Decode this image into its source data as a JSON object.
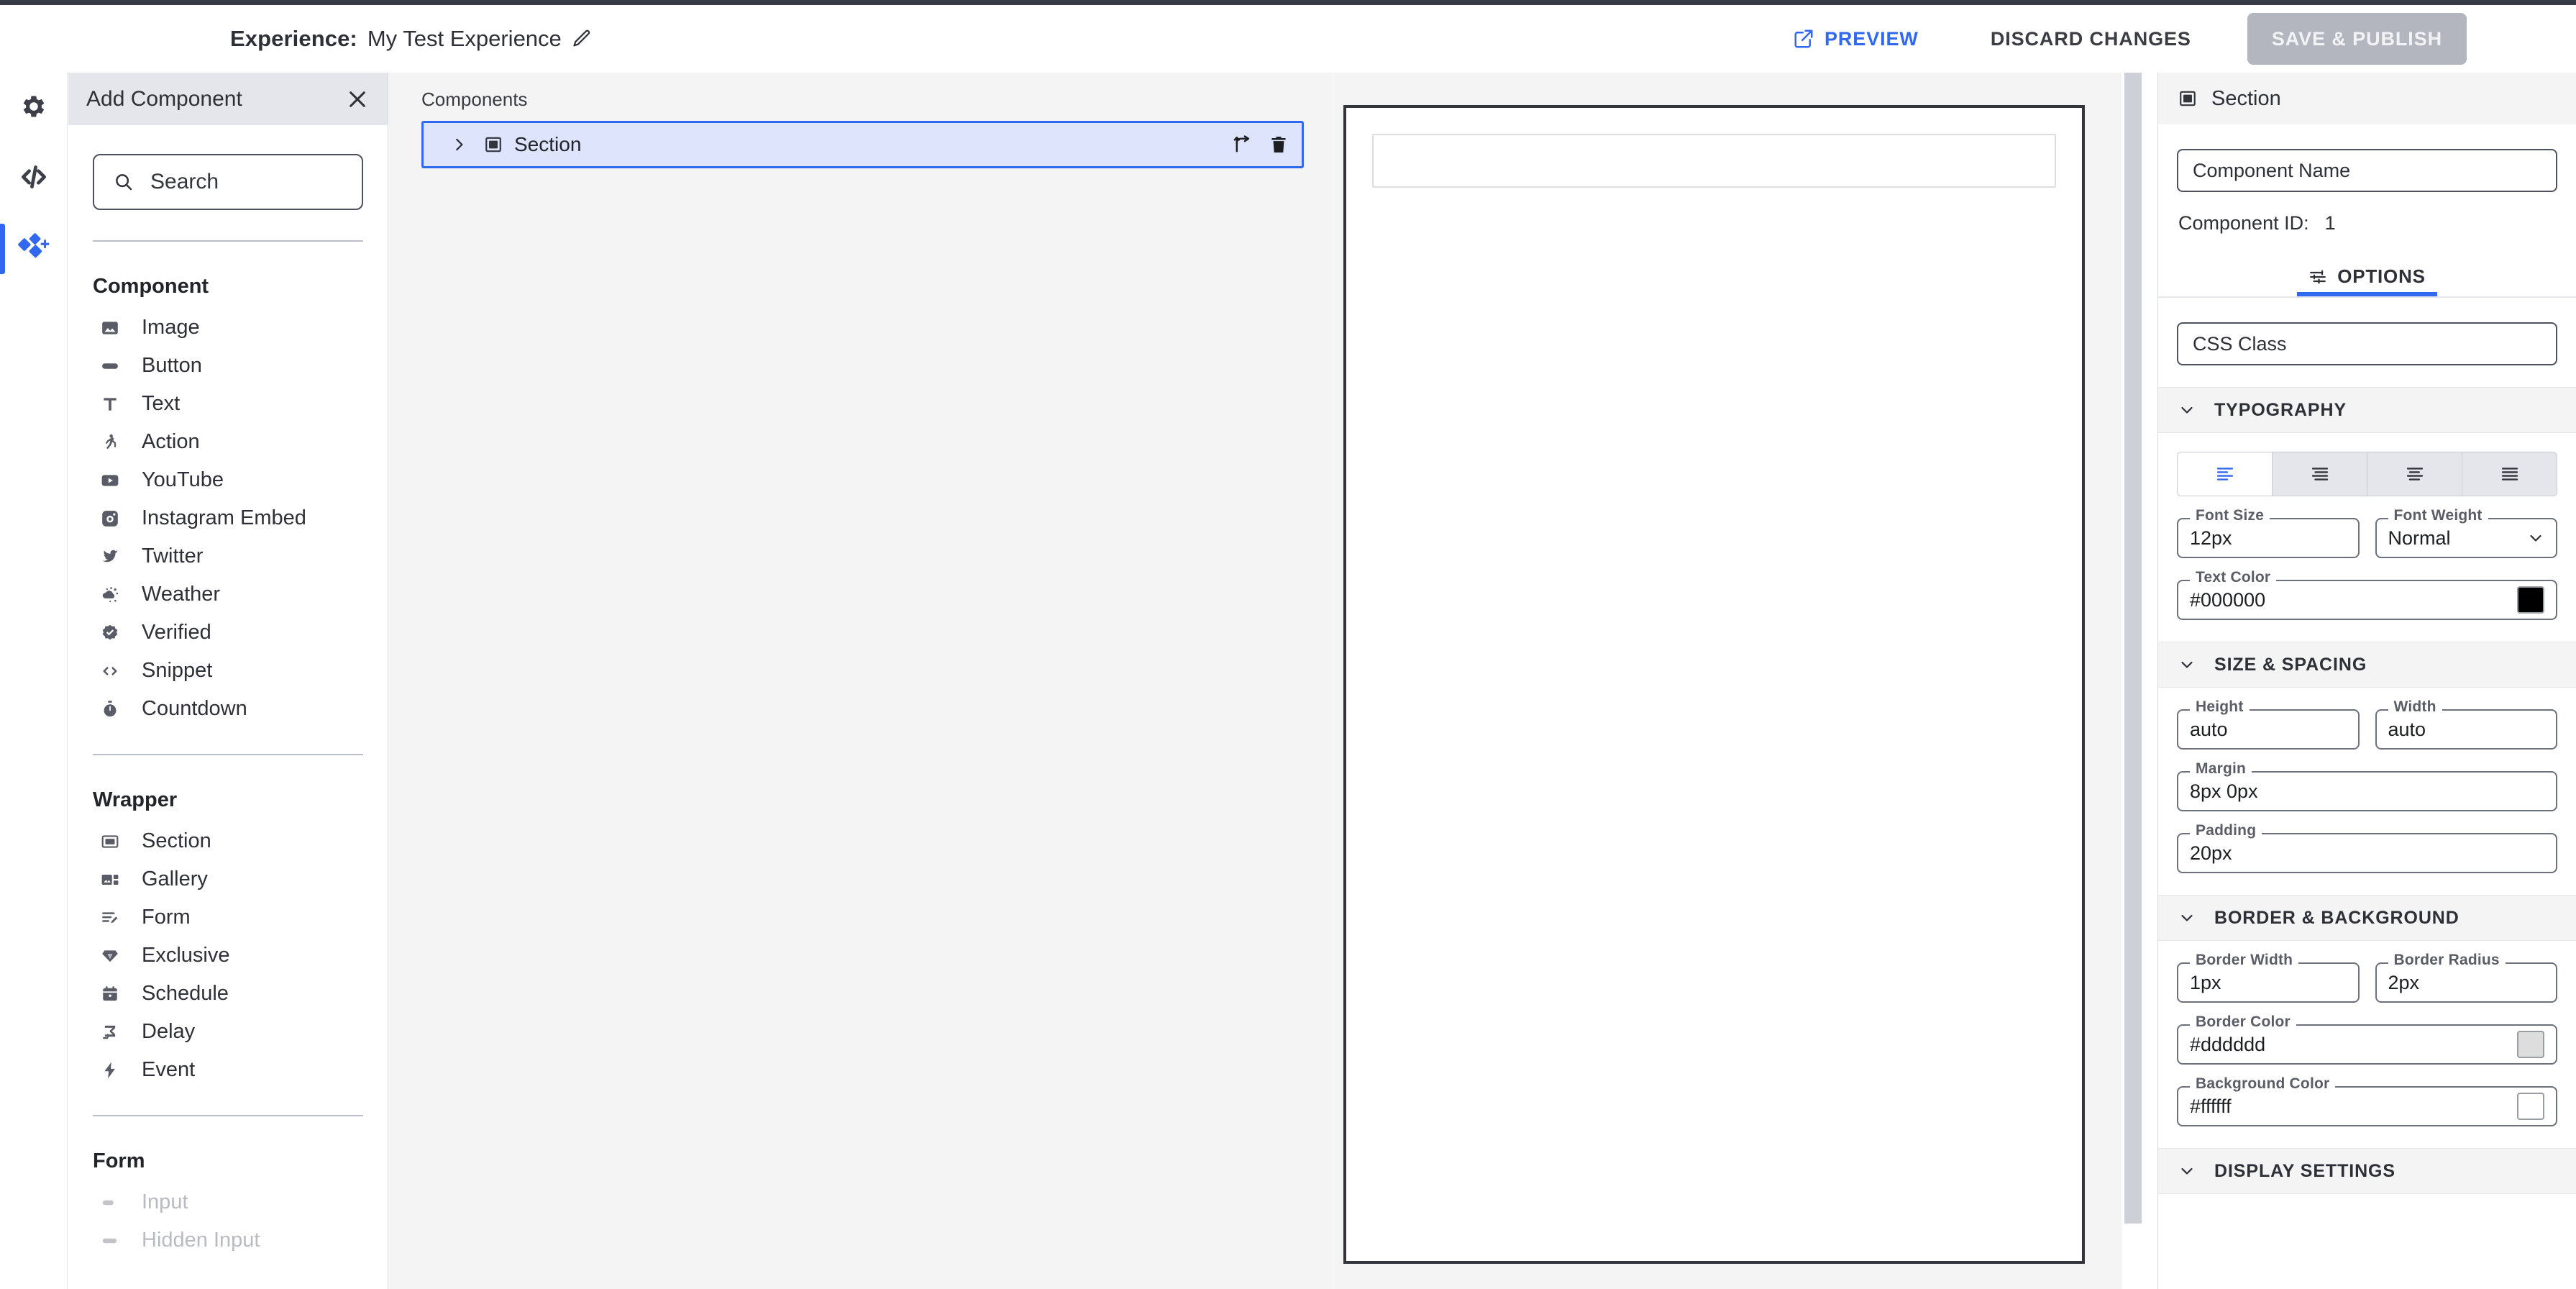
{
  "header": {
    "experience_label": "Experience:",
    "experience_name": "My Test Experience",
    "edit_icon": "pencil-icon",
    "preview_label": "PREVIEW",
    "preview_icon": "external-link-icon",
    "discard_label": "DISCARD CHANGES",
    "publish_label": "SAVE & PUBLISH",
    "accent_color": "#3069f0",
    "publish_disabled_color": "#b3b6be"
  },
  "rail": {
    "items": [
      {
        "icon": "gear-icon",
        "name": "settings",
        "active": false
      },
      {
        "icon": "code-icon",
        "name": "code",
        "active": false
      },
      {
        "icon": "add-component-icon",
        "name": "add-component",
        "active": true
      }
    ]
  },
  "add_panel": {
    "title": "Add Component",
    "close_icon": "close-icon",
    "search": {
      "placeholder": "Search",
      "icon": "search-icon",
      "value": ""
    },
    "groups": [
      {
        "title": "Component",
        "items": [
          {
            "label": "Image",
            "icon": "image-icon",
            "disabled": false
          },
          {
            "label": "Button",
            "icon": "button-icon",
            "disabled": false
          },
          {
            "label": "Text",
            "icon": "text-icon",
            "disabled": false
          },
          {
            "label": "Action",
            "icon": "action-run-icon",
            "disabled": false
          },
          {
            "label": "YouTube",
            "icon": "youtube-icon",
            "disabled": false
          },
          {
            "label": "Instagram Embed",
            "icon": "instagram-icon",
            "disabled": false
          },
          {
            "label": "Twitter",
            "icon": "twitter-icon",
            "disabled": false
          },
          {
            "label": "Weather",
            "icon": "weather-icon",
            "disabled": false
          },
          {
            "label": "Verified",
            "icon": "verified-badge-icon",
            "disabled": false
          },
          {
            "label": "Snippet",
            "icon": "code-snippet-icon",
            "disabled": false
          },
          {
            "label": "Countdown",
            "icon": "stopwatch-icon",
            "disabled": false
          }
        ]
      },
      {
        "title": "Wrapper",
        "items": [
          {
            "label": "Section",
            "icon": "section-icon",
            "disabled": false
          },
          {
            "label": "Gallery",
            "icon": "gallery-icon",
            "disabled": false
          },
          {
            "label": "Form",
            "icon": "form-icon",
            "disabled": false
          },
          {
            "label": "Exclusive",
            "icon": "diamond-icon",
            "disabled": false
          },
          {
            "label": "Schedule",
            "icon": "calendar-icon",
            "disabled": false
          },
          {
            "label": "Delay",
            "icon": "delay-icon",
            "disabled": false
          },
          {
            "label": "Event",
            "icon": "bolt-icon",
            "disabled": false
          }
        ]
      },
      {
        "title": "Form",
        "items": [
          {
            "label": "Input",
            "icon": "input-icon",
            "disabled": true
          },
          {
            "label": "Hidden Input",
            "icon": "hidden-input-icon",
            "disabled": true
          }
        ]
      }
    ]
  },
  "tree": {
    "label": "Components",
    "rows": [
      {
        "name": "Section",
        "icon": "section-icon",
        "chevron": "chevron-right-icon",
        "selected": true,
        "actions": [
          {
            "icon": "branch-icon",
            "name": "move-component"
          },
          {
            "icon": "trash-icon",
            "name": "delete-component"
          }
        ]
      }
    ],
    "selected_border_color": "#3069f0",
    "selected_fill_color": "#dde4fb"
  },
  "inspector": {
    "title": "Section",
    "title_icon": "section-icon",
    "component_name_placeholder": "Component Name",
    "component_name_value": "",
    "component_id_label": "Component ID:",
    "component_id_value": "1",
    "tabs": [
      {
        "label": "OPTIONS",
        "icon": "tune-icon",
        "active": true
      }
    ],
    "css_class_placeholder": "CSS Class",
    "css_class_value": "",
    "sections": [
      {
        "title": "TYPOGRAPHY",
        "chevron": "chevron-down-icon",
        "align_buttons": [
          {
            "name": "align-left",
            "icon": "align-left-icon",
            "active": true
          },
          {
            "name": "align-center",
            "icon": "align-center-icon",
            "active": false
          },
          {
            "name": "align-right",
            "icon": "align-right-icon",
            "active": false
          },
          {
            "name": "align-justify",
            "icon": "align-justify-icon",
            "active": false
          }
        ],
        "fields": [
          {
            "label": "Font Size",
            "value": "12px",
            "type": "text"
          },
          {
            "label": "Font Weight",
            "value": "Normal",
            "type": "select"
          },
          {
            "label": "Text Color",
            "value": "#000000",
            "type": "color",
            "swatch": "#000000"
          }
        ]
      },
      {
        "title": "SIZE & SPACING",
        "chevron": "chevron-down-icon",
        "fields": [
          {
            "label": "Height",
            "value": "auto",
            "type": "text"
          },
          {
            "label": "Width",
            "value": "auto",
            "type": "text"
          },
          {
            "label": "Margin",
            "value": "8px 0px",
            "type": "text"
          },
          {
            "label": "Padding",
            "value": "20px",
            "type": "text"
          }
        ]
      },
      {
        "title": "BORDER & BACKGROUND",
        "chevron": "chevron-down-icon",
        "fields": [
          {
            "label": "Border Width",
            "value": "1px",
            "type": "text"
          },
          {
            "label": "Border Radius",
            "value": "2px",
            "type": "text"
          },
          {
            "label": "Border Color",
            "value": "#dddddd",
            "type": "color",
            "swatch": "#dddddd"
          },
          {
            "label": "Background Color",
            "value": "#ffffff",
            "type": "color",
            "swatch": "#ffffff"
          }
        ]
      },
      {
        "title": "DISPLAY SETTINGS",
        "chevron": "chevron-down-icon",
        "fields": []
      }
    ]
  }
}
